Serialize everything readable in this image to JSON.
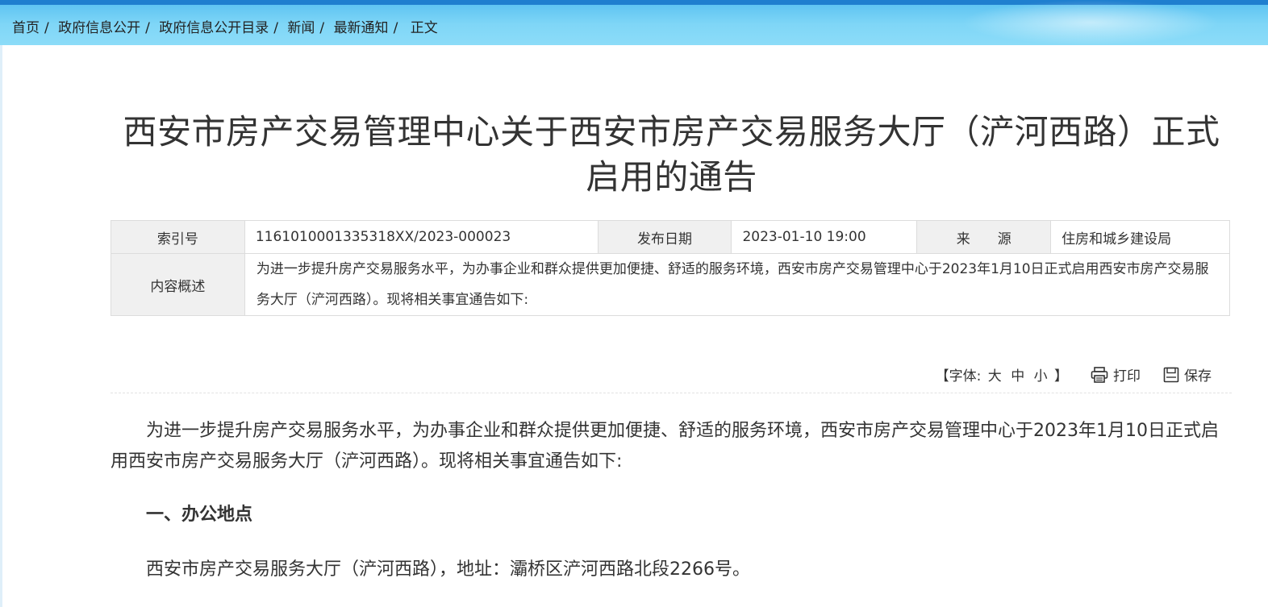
{
  "breadcrumb": {
    "items": [
      "首页",
      "政府信息公开",
      "政府信息公开目录",
      "新闻",
      "最新通知",
      "正文"
    ]
  },
  "article": {
    "title": "西安市房产交易管理中心关于西安市房产交易服务大厅（浐河西路）正式启用的通告"
  },
  "meta": {
    "index_label": "索引号",
    "index_value": "1161010001335318XX/2023-000023",
    "date_label": "发布日期",
    "date_value": "2023-01-10 19:00",
    "source_label": "来　　源",
    "source_value": "住房和城乡建设局",
    "summary_label": "内容概述",
    "summary_value": "为进一步提升房产交易服务水平，为办事企业和群众提供更加便捷、舒适的服务环境，西安市房产交易管理中心于2023年1月10日正式启用西安市房产交易服务大厅（浐河西路）。现将相关事宜通告如下:"
  },
  "tools": {
    "font_open": "【字体:",
    "size_large": "大",
    "size_medium": "中",
    "size_small": "小",
    "font_close": "】",
    "print_label": "打印",
    "save_label": "保存",
    "print_icon": "printer-icon",
    "save_icon": "save-icon"
  },
  "content": {
    "paragraph1": "为进一步提升房产交易服务水平，为办事企业和群众提供更加便捷、舒适的服务环境，西安市房产交易管理中心于2023年1月10日正式启用西安市房产交易服务大厅（浐河西路）。现将相关事宜通告如下:",
    "heading1": "一、办公地点",
    "paragraph2": "西安市房产交易服务大厅（浐河西路），地址：灞桥区浐河西路北段2266号。"
  },
  "colors": {
    "topbar": "#5fc4f2",
    "label_bg": "#f0f0f0",
    "text": "#333333"
  }
}
